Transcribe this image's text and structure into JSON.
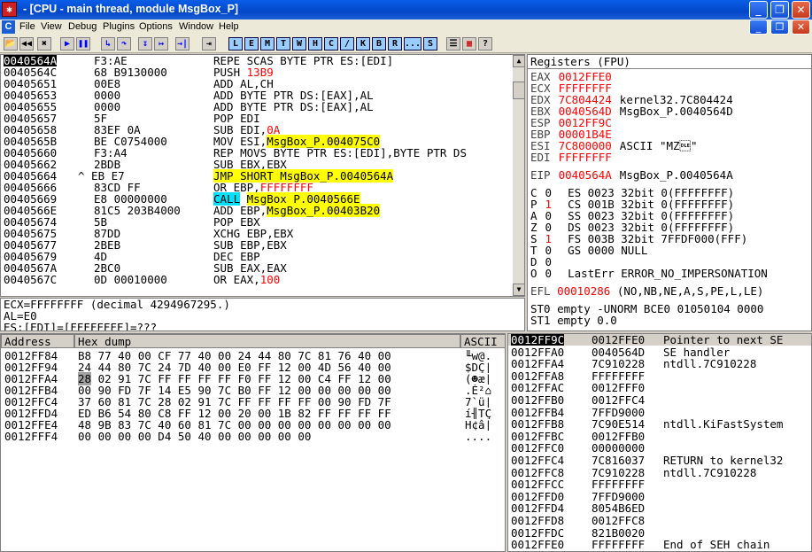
{
  "window": {
    "title": "- [CPU - main thread, module MsgBox_P]"
  },
  "menu": [
    "File",
    "View",
    "Debug",
    "Plugins",
    "Options",
    "Window",
    "Help"
  ],
  "toolbar": {
    "buttons": [
      "📂",
      "◀◀",
      "✖",
      "▶",
      "❚❚",
      "↳",
      "↷",
      "↧",
      "↦",
      "→|",
      "⇥"
    ],
    "letters": [
      "L",
      "E",
      "M",
      "T",
      "W",
      "H",
      "C",
      "/",
      "K",
      "B",
      "R",
      "...",
      "S"
    ]
  },
  "disasm": [
    {
      "addr": "0040564A",
      "hex": "F3:AE",
      "instr": "REPE SCAS BYTE PTR ES:[EDI]",
      "selected": true
    },
    {
      "addr": "0040564C",
      "hex": "68 B9130000",
      "instr": "PUSH 13B9"
    },
    {
      "addr": "00405651",
      "hex": "00E8",
      "instr": "ADD AL,CH"
    },
    {
      "addr": "00405653",
      "hex": "0000",
      "instr": "ADD BYTE PTR DS:[EAX],AL"
    },
    {
      "addr": "00405655",
      "hex": "0000",
      "instr": "ADD BYTE PTR DS:[EAX],AL"
    },
    {
      "addr": "00405657",
      "hex": "5F",
      "instr": "POP EDI"
    },
    {
      "addr": "00405658",
      "hex": "83EF 0A",
      "instr": "SUB EDI,0A"
    },
    {
      "addr": "0040565B",
      "hex": "BE C0754000",
      "instr": "MOV ESI,MsgBox_P.004075C0"
    },
    {
      "addr": "00405660",
      "hex": "F3:A4",
      "instr": "REP MOVS BYTE PTR ES:[EDI],BYTE PTR DS"
    },
    {
      "addr": "00405662",
      "hex": "2BDB",
      "instr": "SUB EBX,EBX"
    },
    {
      "addr": "00405664",
      "hex": "^ EB E7",
      "instr": "JMP SHORT MsgBox_P.0040564A"
    },
    {
      "addr": "00405666",
      "hex": "83CD FF",
      "instr": "OR EBP,FFFFFFFF"
    },
    {
      "addr": "00405669",
      "hex": "E8 00000000",
      "instr": "CALL MsgBox_P.0040566E"
    },
    {
      "addr": "0040566E",
      "hex": "81C5 203B4000",
      "instr": "ADD EBP,MsgBox_P.00403B20"
    },
    {
      "addr": "00405674",
      "hex": "5B",
      "instr": "POP EBX"
    },
    {
      "addr": "00405675",
      "hex": "87DD",
      "instr": "XCHG EBP,EBX"
    },
    {
      "addr": "00405677",
      "hex": "2BEB",
      "instr": "SUB EBP,EBX"
    },
    {
      "addr": "00405679",
      "hex": "4D",
      "instr": "DEC EBP"
    },
    {
      "addr": "0040567A",
      "hex": "2BC0",
      "instr": "SUB EAX,EAX"
    },
    {
      "addr": "0040567C",
      "hex": "0D 00010000",
      "instr": "OR EAX,100"
    }
  ],
  "info": [
    "ECX=FFFFFFFF (decimal 4294967295.)",
    "AL=E0",
    "ES:[EDI]=[FFFFFFFF]=???"
  ],
  "registers": {
    "header": "Registers (FPU)",
    "gp": [
      {
        "name": "EAX",
        "val": "0012FFE0",
        "note": ""
      },
      {
        "name": "ECX",
        "val": "FFFFFFFF",
        "note": ""
      },
      {
        "name": "EDX",
        "val": "7C804424",
        "note": "kernel32.7C804424"
      },
      {
        "name": "EBX",
        "val": "0040564D",
        "note": "MsgBox_P.0040564D"
      },
      {
        "name": "ESP",
        "val": "0012FF9C",
        "note": ""
      },
      {
        "name": "EBP",
        "val": "00001B4E",
        "note": ""
      },
      {
        "name": "ESI",
        "val": "7C800000",
        "note": "ASCII \"MZ\u0010\""
      },
      {
        "name": "EDI",
        "val": "FFFFFFFF",
        "note": ""
      }
    ],
    "eip": {
      "name": "EIP",
      "val": "0040564A",
      "note": "MsgBox_P.0040564A"
    },
    "flags": [
      {
        "f": "C",
        "v": "0",
        "seg": "ES 0023 32bit 0(FFFFFFFF)"
      },
      {
        "f": "P",
        "v": "1",
        "seg": "CS 001B 32bit 0(FFFFFFFF)"
      },
      {
        "f": "A",
        "v": "0",
        "seg": "SS 0023 32bit 0(FFFFFFFF)"
      },
      {
        "f": "Z",
        "v": "0",
        "seg": "DS 0023 32bit 0(FFFFFFFF)"
      },
      {
        "f": "S",
        "v": "1",
        "seg": "FS 003B 32bit 7FFDF000(FFF)"
      },
      {
        "f": "T",
        "v": "0",
        "seg": "GS 0000 NULL"
      },
      {
        "f": "D",
        "v": "0",
        "seg": ""
      },
      {
        "f": "O",
        "v": "0",
        "seg": "LastErr ERROR_NO_IMPERSONATION"
      }
    ],
    "efl": "EFL 00010286 (NO,NB,NE,A,S,PE,L,LE)",
    "fpu": [
      "ST0 empty -UNORM BCE0 01050104 0000",
      "ST1 empty 0.0"
    ]
  },
  "dump": {
    "headers": [
      "Address",
      "Hex dump",
      "ASCII"
    ],
    "rows": [
      {
        "addr": "0012FF84",
        "hex": "B8 77 40 00 CF 77 40 00 24 44 80 7C 81 76 40 00",
        "ascii": "╙w@."
      },
      {
        "addr": "0012FF94",
        "hex": "24 44 80 7C 24 7D 40 00 E0 FF 12 00 4D 56 40 00",
        "ascii": "$DÇ|"
      },
      {
        "addr": "0012FFA4",
        "hex": "28 02 91 7C FF FF FF FF F0 FF 12 00 C4 FF 12 00",
        "ascii": "(☻æ|"
      },
      {
        "addr": "0012FFB4",
        "hex": "00 90 FD 7F 14 E5 90 7C B0 FF 12 00 00 00 00 00",
        "ascii": ".É²⌂"
      },
      {
        "addr": "0012FFC4",
        "hex": "37 60 81 7C 28 02 91 7C FF FF FF FF 00 90 FD 7F",
        "ascii": "7`ü|"
      },
      {
        "addr": "0012FFD4",
        "hex": "ED B6 54 80 C8 FF 12 00 20 00 1B 82 FF FF FF FF",
        "ascii": "í╢TÇ"
      },
      {
        "addr": "0012FFE4",
        "hex": "48 9B 83 7C 40 60 81 7C 00 00 00 00 00 00 00 00",
        "ascii": "H¢â|"
      },
      {
        "addr": "0012FFF4",
        "hex": "00 00 00 00 D4 50 40 00 00 00 00 00",
        "ascii": "...."
      }
    ]
  },
  "stack": {
    "top": "0012FF9C",
    "rows": [
      {
        "addr": "0012FF9C",
        "val": "0012FFE0",
        "comment": "Pointer to next SE",
        "sel": true
      },
      {
        "addr": "0012FFA0",
        "val": "0040564D",
        "comment": "SE handler"
      },
      {
        "addr": "0012FFA4",
        "val": "7C910228",
        "comment": "ntdll.7C910228"
      },
      {
        "addr": "0012FFA8",
        "val": "FFFFFFFF",
        "comment": ""
      },
      {
        "addr": "0012FFAC",
        "val": "0012FFF0",
        "comment": ""
      },
      {
        "addr": "0012FFB0",
        "val": "0012FFC4",
        "comment": ""
      },
      {
        "addr": "0012FFB4",
        "val": "7FFD9000",
        "comment": ""
      },
      {
        "addr": "0012FFB8",
        "val": "7C90E514",
        "comment": "ntdll.KiFastSystem"
      },
      {
        "addr": "0012FFBC",
        "val": "0012FFB0",
        "comment": ""
      },
      {
        "addr": "0012FFC0",
        "val": "00000000",
        "comment": ""
      },
      {
        "addr": "0012FFC4",
        "val": "7C816037",
        "comment": "RETURN to kernel32"
      },
      {
        "addr": "0012FFC8",
        "val": "7C910228",
        "comment": "ntdll.7C910228"
      },
      {
        "addr": "0012FFCC",
        "val": "FFFFFFFF",
        "comment": ""
      },
      {
        "addr": "0012FFD0",
        "val": "7FFD9000",
        "comment": ""
      },
      {
        "addr": "0012FFD4",
        "val": "8054B6ED",
        "comment": ""
      },
      {
        "addr": "0012FFD8",
        "val": "0012FFC8",
        "comment": ""
      },
      {
        "addr": "0012FFDC",
        "val": "821B0020",
        "comment": ""
      },
      {
        "addr": "0012FFE0",
        "val": "FFFFFFFF",
        "comment": "End of SEH chain"
      }
    ]
  },
  "colors": {
    "accent": "#0a5ee8",
    "highlight": "#ffff00",
    "call": "#00e0ff",
    "changed": "#ff0000"
  }
}
